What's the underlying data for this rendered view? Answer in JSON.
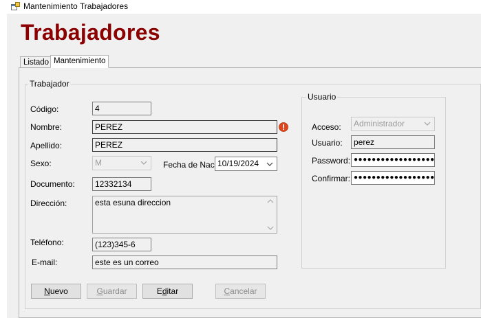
{
  "window": {
    "title": "Mantenimiento Trabajadores",
    "icon": "app-window-icon"
  },
  "heading": "Trabajadores",
  "tabs": [
    {
      "label": "Listado",
      "active": false
    },
    {
      "label": "Mantenimiento",
      "active": true
    }
  ],
  "trabajador": {
    "group_label": "Trabajador",
    "codigo": {
      "label": "Código:",
      "value": "4"
    },
    "nombre": {
      "label": "Nombre:",
      "value": "PEREZ",
      "error_icon": "error-icon"
    },
    "apellido": {
      "label": "Apellido:",
      "value": "PEREZ"
    },
    "sexo": {
      "label": "Sexo:",
      "value": "M"
    },
    "fecha_nac": {
      "label": "Fecha de Nac:",
      "value": "10/19/2024"
    },
    "documento": {
      "label": "Documento:",
      "value": "12332134"
    },
    "direccion": {
      "label": "Dirección:",
      "value": "esta esuna direccion"
    },
    "telefono": {
      "label": "Teléfono:",
      "value": "(123)345-6"
    },
    "email": {
      "label": "E-mail:",
      "value": "este es un correo"
    }
  },
  "usuario": {
    "group_label": "Usuario",
    "acceso": {
      "label": "Acceso:",
      "value": "Administrador"
    },
    "usuario": {
      "label": "Usuario:",
      "value": "perez"
    },
    "password": {
      "label": "Password:",
      "value": "●●●●●●●●●●●●●●●●●●●●"
    },
    "confirmar": {
      "label": "Confirmar:",
      "value": "●●●●●●●●●●●●●●●●●●●●"
    }
  },
  "buttons": {
    "nuevo": {
      "mnemonic": "N",
      "rest": "uevo",
      "enabled": true
    },
    "guardar": {
      "mnemonic": "G",
      "rest": "uardar",
      "enabled": false
    },
    "editar": {
      "prefix": "E",
      "mnemonic": "d",
      "rest": "itar",
      "enabled": true
    },
    "cancelar": {
      "mnemonic": "C",
      "rest": "ancelar",
      "enabled": false
    }
  },
  "colors": {
    "heading": "#8b0000",
    "error": "#e2441c"
  }
}
